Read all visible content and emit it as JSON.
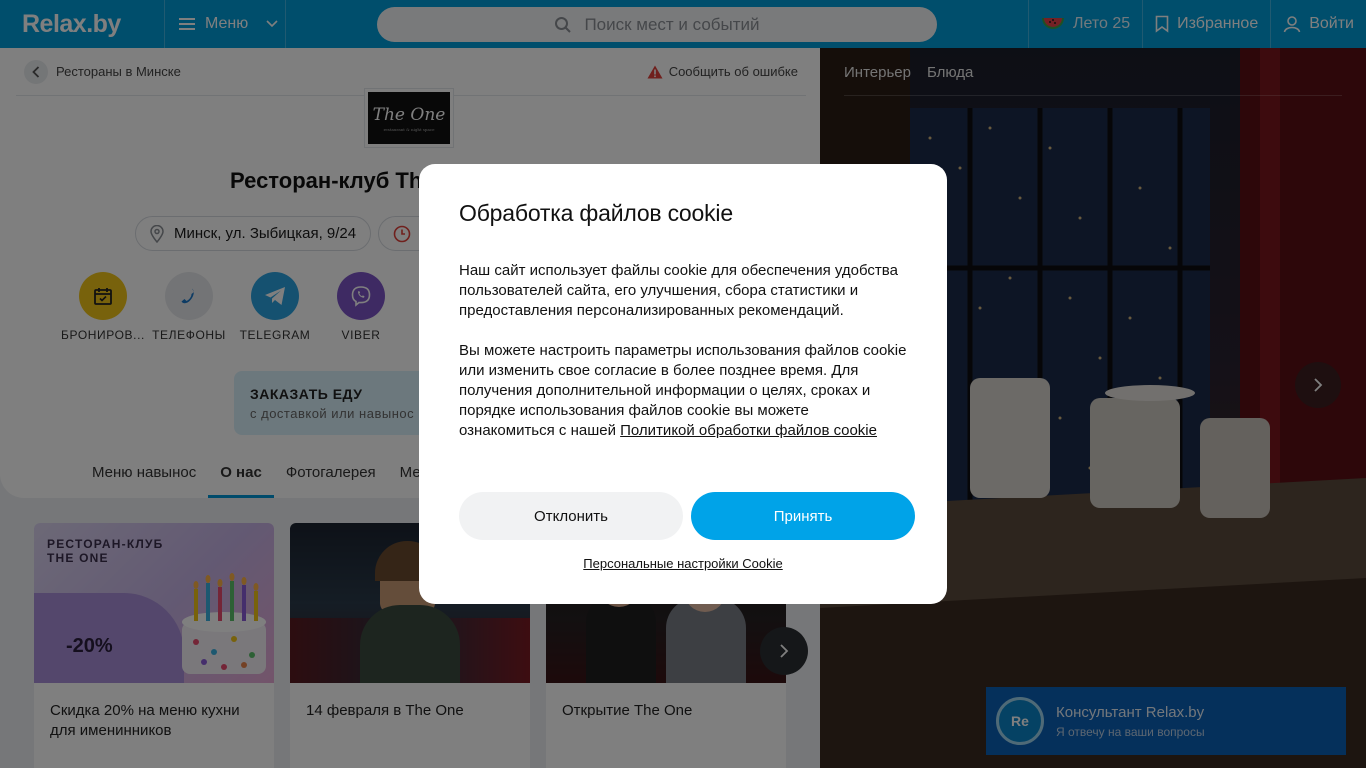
{
  "header": {
    "logo": "Relax.by",
    "menu_label": "Меню",
    "search_placeholder": "Поиск мест и событий",
    "summer_label": "Лето 25",
    "favorites_label": "Избранное",
    "login_label": "Войти"
  },
  "breadcrumb": {
    "label": "Рестораны в Минске",
    "report": "Сообщить об ошибке"
  },
  "venue": {
    "logo_text": "The One",
    "logo_sub": "restaurant & night space",
    "title": "Ресторан-клуб The One",
    "address": "Минск, ул. Зыбицкая, 9/24"
  },
  "actions": [
    {
      "label": "БРОНИРОВ...",
      "icon": "calendar-icon",
      "color": "#f0c419"
    },
    {
      "label": "ТЕЛЕФОНЫ",
      "icon": "phone-icon",
      "color": "#e6e9ec"
    },
    {
      "label": "TELEGRAM",
      "icon": "telegram-icon",
      "color": "#2aa3e0"
    },
    {
      "label": "VIBER",
      "icon": "viber-icon",
      "color": "#7d55c7"
    }
  ],
  "order": {
    "title": "ЗАКАЗАТЬ ЕДУ",
    "subtitle": "с доставкой или навынос"
  },
  "tabs": [
    "Меню навынос",
    "О нас",
    "Фотогалерея",
    "Ме"
  ],
  "cards": [
    {
      "badge": "РЕСТОРАН-КЛУБ\nTHE ONE",
      "discount": "-20%",
      "caption": "Скидка 20% на меню кухни для именинников"
    },
    {
      "caption": "14 февраля в The One"
    },
    {
      "caption": "Открытие The One"
    }
  ],
  "photo_tabs": [
    "Интерьер",
    "Блюда"
  ],
  "chat": {
    "avatar": "Re",
    "name": "Консультант Relax.by",
    "desc": "Я отвечу на ваши вопросы"
  },
  "cookie": {
    "title": "Обработка файлов cookie",
    "p1": "Наш сайт использует файлы cookie для обеспечения удобства пользователей сайта, его улучшения, сбора статистики и предоставления персонализированных рекомендаций.",
    "p2": "Вы можете настроить параметры использования файлов cookie или изменить свое согласие в более позднее время. Для получения дополнительной информации о целях, сроках и порядке использования файлов cookie вы можете ознакомиться с нашей ",
    "policy_link": "Политикой обработки файлов cookie",
    "decline": "Отклонить",
    "accept": "Принять",
    "personal": "Персональные настройки Cookie"
  },
  "colors": {
    "brand": "#009dd9",
    "accept": "#00a3e8",
    "chat": "#0b60b6",
    "tab_active": "#0096d6"
  }
}
